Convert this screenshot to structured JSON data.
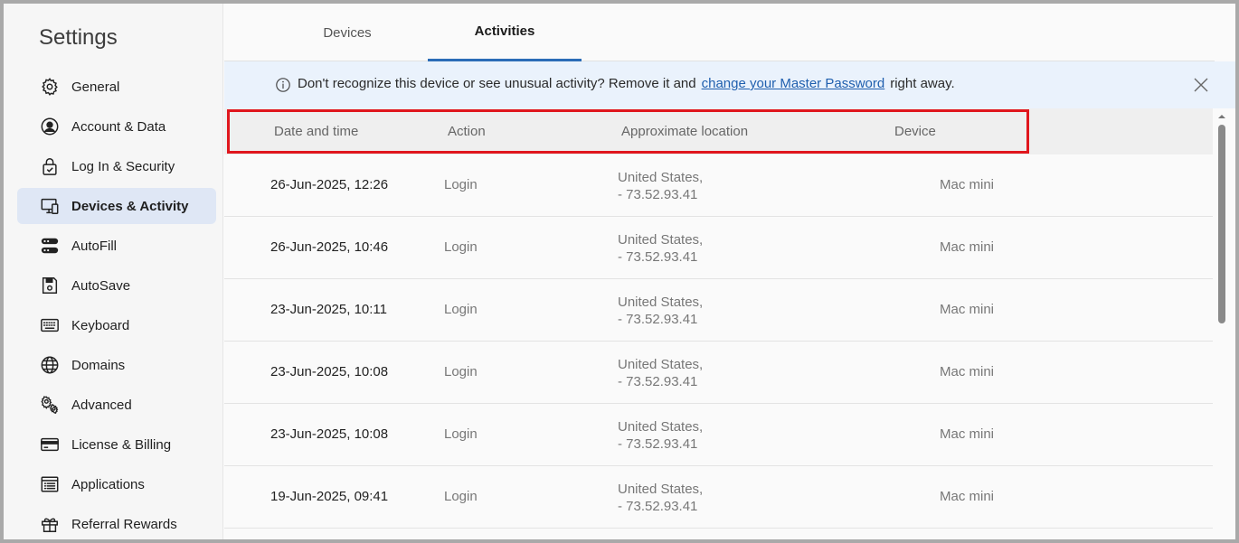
{
  "sidebar": {
    "title": "Settings",
    "items": [
      {
        "label": "General",
        "icon": "gear-icon"
      },
      {
        "label": "Account & Data",
        "icon": "user-circle-icon"
      },
      {
        "label": "Log In & Security",
        "icon": "lock-check-icon"
      },
      {
        "label": "Devices & Activity",
        "icon": "devices-icon",
        "active": true
      },
      {
        "label": "AutoFill",
        "icon": "autofill-icon"
      },
      {
        "label": "AutoSave",
        "icon": "save-icon"
      },
      {
        "label": "Keyboard",
        "icon": "keyboard-icon"
      },
      {
        "label": "Domains",
        "icon": "globe-icon"
      },
      {
        "label": "Advanced",
        "icon": "gears-icon"
      },
      {
        "label": "License & Billing",
        "icon": "credit-card-icon"
      },
      {
        "label": "Applications",
        "icon": "applications-icon"
      },
      {
        "label": "Referral Rewards",
        "icon": "gift-icon"
      }
    ]
  },
  "tabs": [
    {
      "label": "Devices",
      "active": false
    },
    {
      "label": "Activities",
      "active": true
    }
  ],
  "banner": {
    "text_before": "Don't recognize this device or see unusual activity? Remove it and",
    "link": "change your Master Password",
    "text_after": "right away."
  },
  "table": {
    "columns": [
      "Date and time",
      "Action",
      "Approximate location",
      "Device"
    ],
    "rows": [
      {
        "date": "26-Jun-2025, 12:26",
        "action": "Login",
        "location_line1": "United States,",
        "location_line2": "- 73.52.93.41",
        "device": "Mac mini"
      },
      {
        "date": "26-Jun-2025, 10:46",
        "action": "Login",
        "location_line1": "United States,",
        "location_line2": "- 73.52.93.41",
        "device": "Mac mini"
      },
      {
        "date": "23-Jun-2025, 10:11",
        "action": "Login",
        "location_line1": "United States,",
        "location_line2": "- 73.52.93.41",
        "device": "Mac mini"
      },
      {
        "date": "23-Jun-2025, 10:08",
        "action": "Login",
        "location_line1": "United States,",
        "location_line2": "- 73.52.93.41",
        "device": "Mac mini"
      },
      {
        "date": "23-Jun-2025, 10:08",
        "action": "Login",
        "location_line1": "United States,",
        "location_line2": "- 73.52.93.41",
        "device": "Mac mini"
      },
      {
        "date": "19-Jun-2025, 09:41",
        "action": "Login",
        "location_line1": "United States,",
        "location_line2": "- 73.52.93.41",
        "device": "Mac mini"
      }
    ]
  },
  "colors": {
    "accent": "#2b6cb7",
    "highlight": "#e0161d",
    "active_nav_bg": "#dfe7f5",
    "banner_bg": "#eaf2fc"
  }
}
